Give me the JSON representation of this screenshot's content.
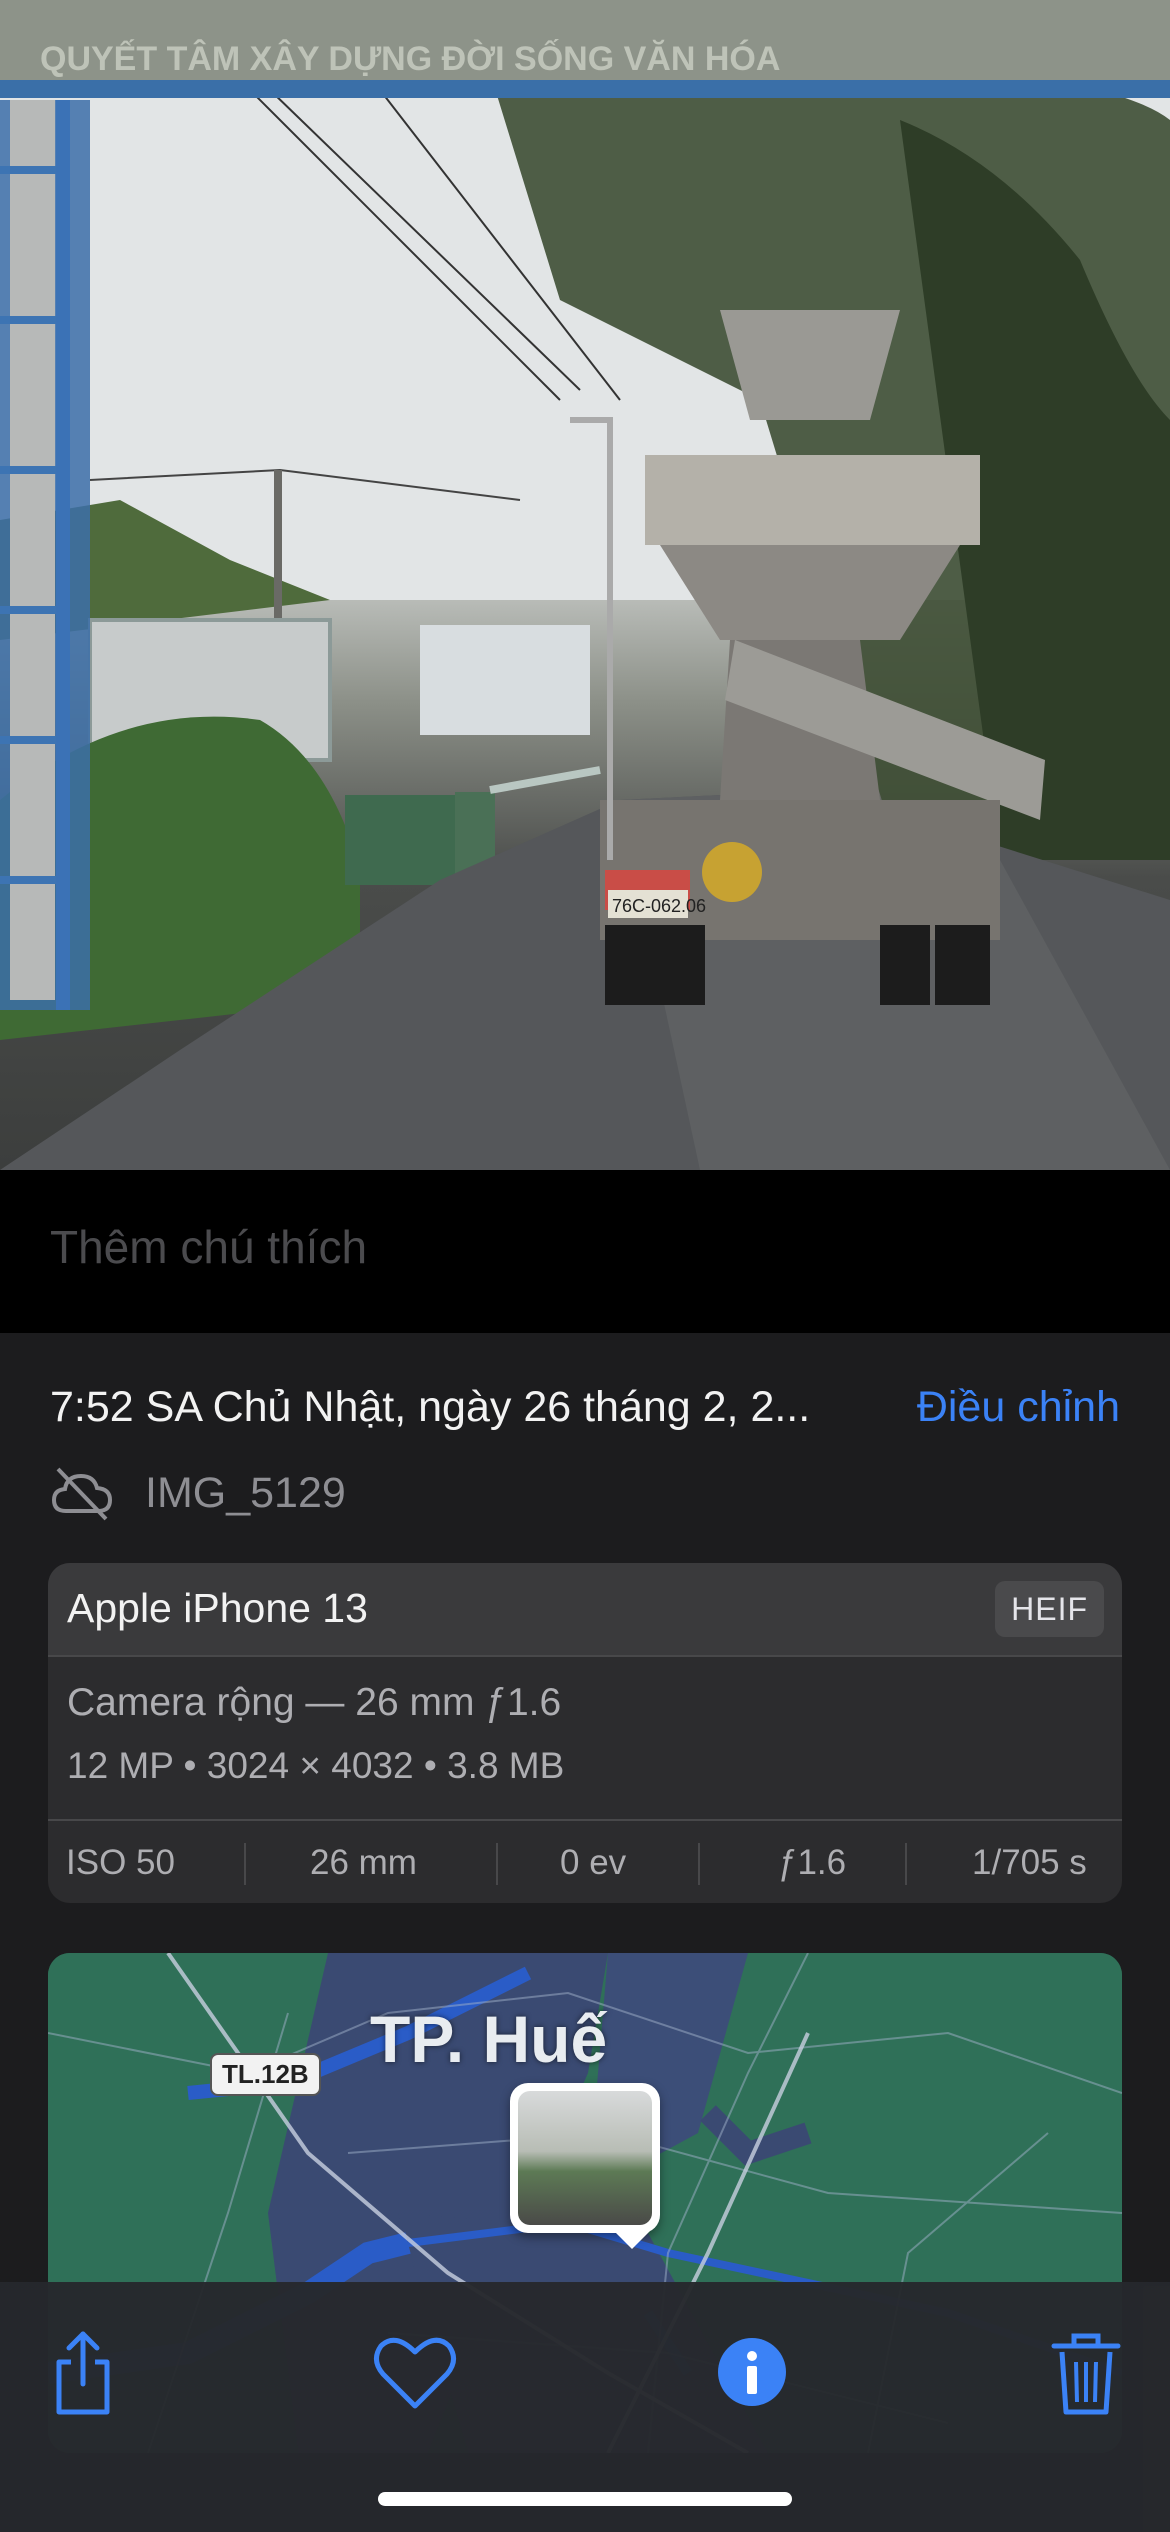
{
  "photo": {
    "sign_text": "QUYẾT TÂM XÂY DỰNG ĐỜI SỐNG VĂN HÓA",
    "plate_text": "76C-062.06"
  },
  "caption": {
    "placeholder": "Thêm chú thích"
  },
  "info": {
    "date": "7:52 SA Chủ Nhật, ngày 26 tháng 2, 2...",
    "adjust_label": "Điều chỉnh",
    "file_name": "IMG_5129"
  },
  "camera": {
    "device": "Apple iPhone 13",
    "format": "HEIF",
    "lens": "Camera rộng — 26 mm ƒ1.6",
    "specs": "12 MP  •  3024 × 4032  •  3.8 MB",
    "iso": "ISO 50",
    "focal": "26 mm",
    "ev": "0 ev",
    "aperture": "ƒ1.6",
    "shutter": "1/705 s"
  },
  "map": {
    "city": "TP. Huế",
    "road": "TL.12B"
  },
  "toolbar": {
    "share": "share-icon",
    "favorite": "heart-icon",
    "info": "info-icon",
    "delete": "trash-icon"
  },
  "colors": {
    "accent": "#3b82f6",
    "sheet": "#1c1c1e",
    "card": "#2c2c2e"
  }
}
